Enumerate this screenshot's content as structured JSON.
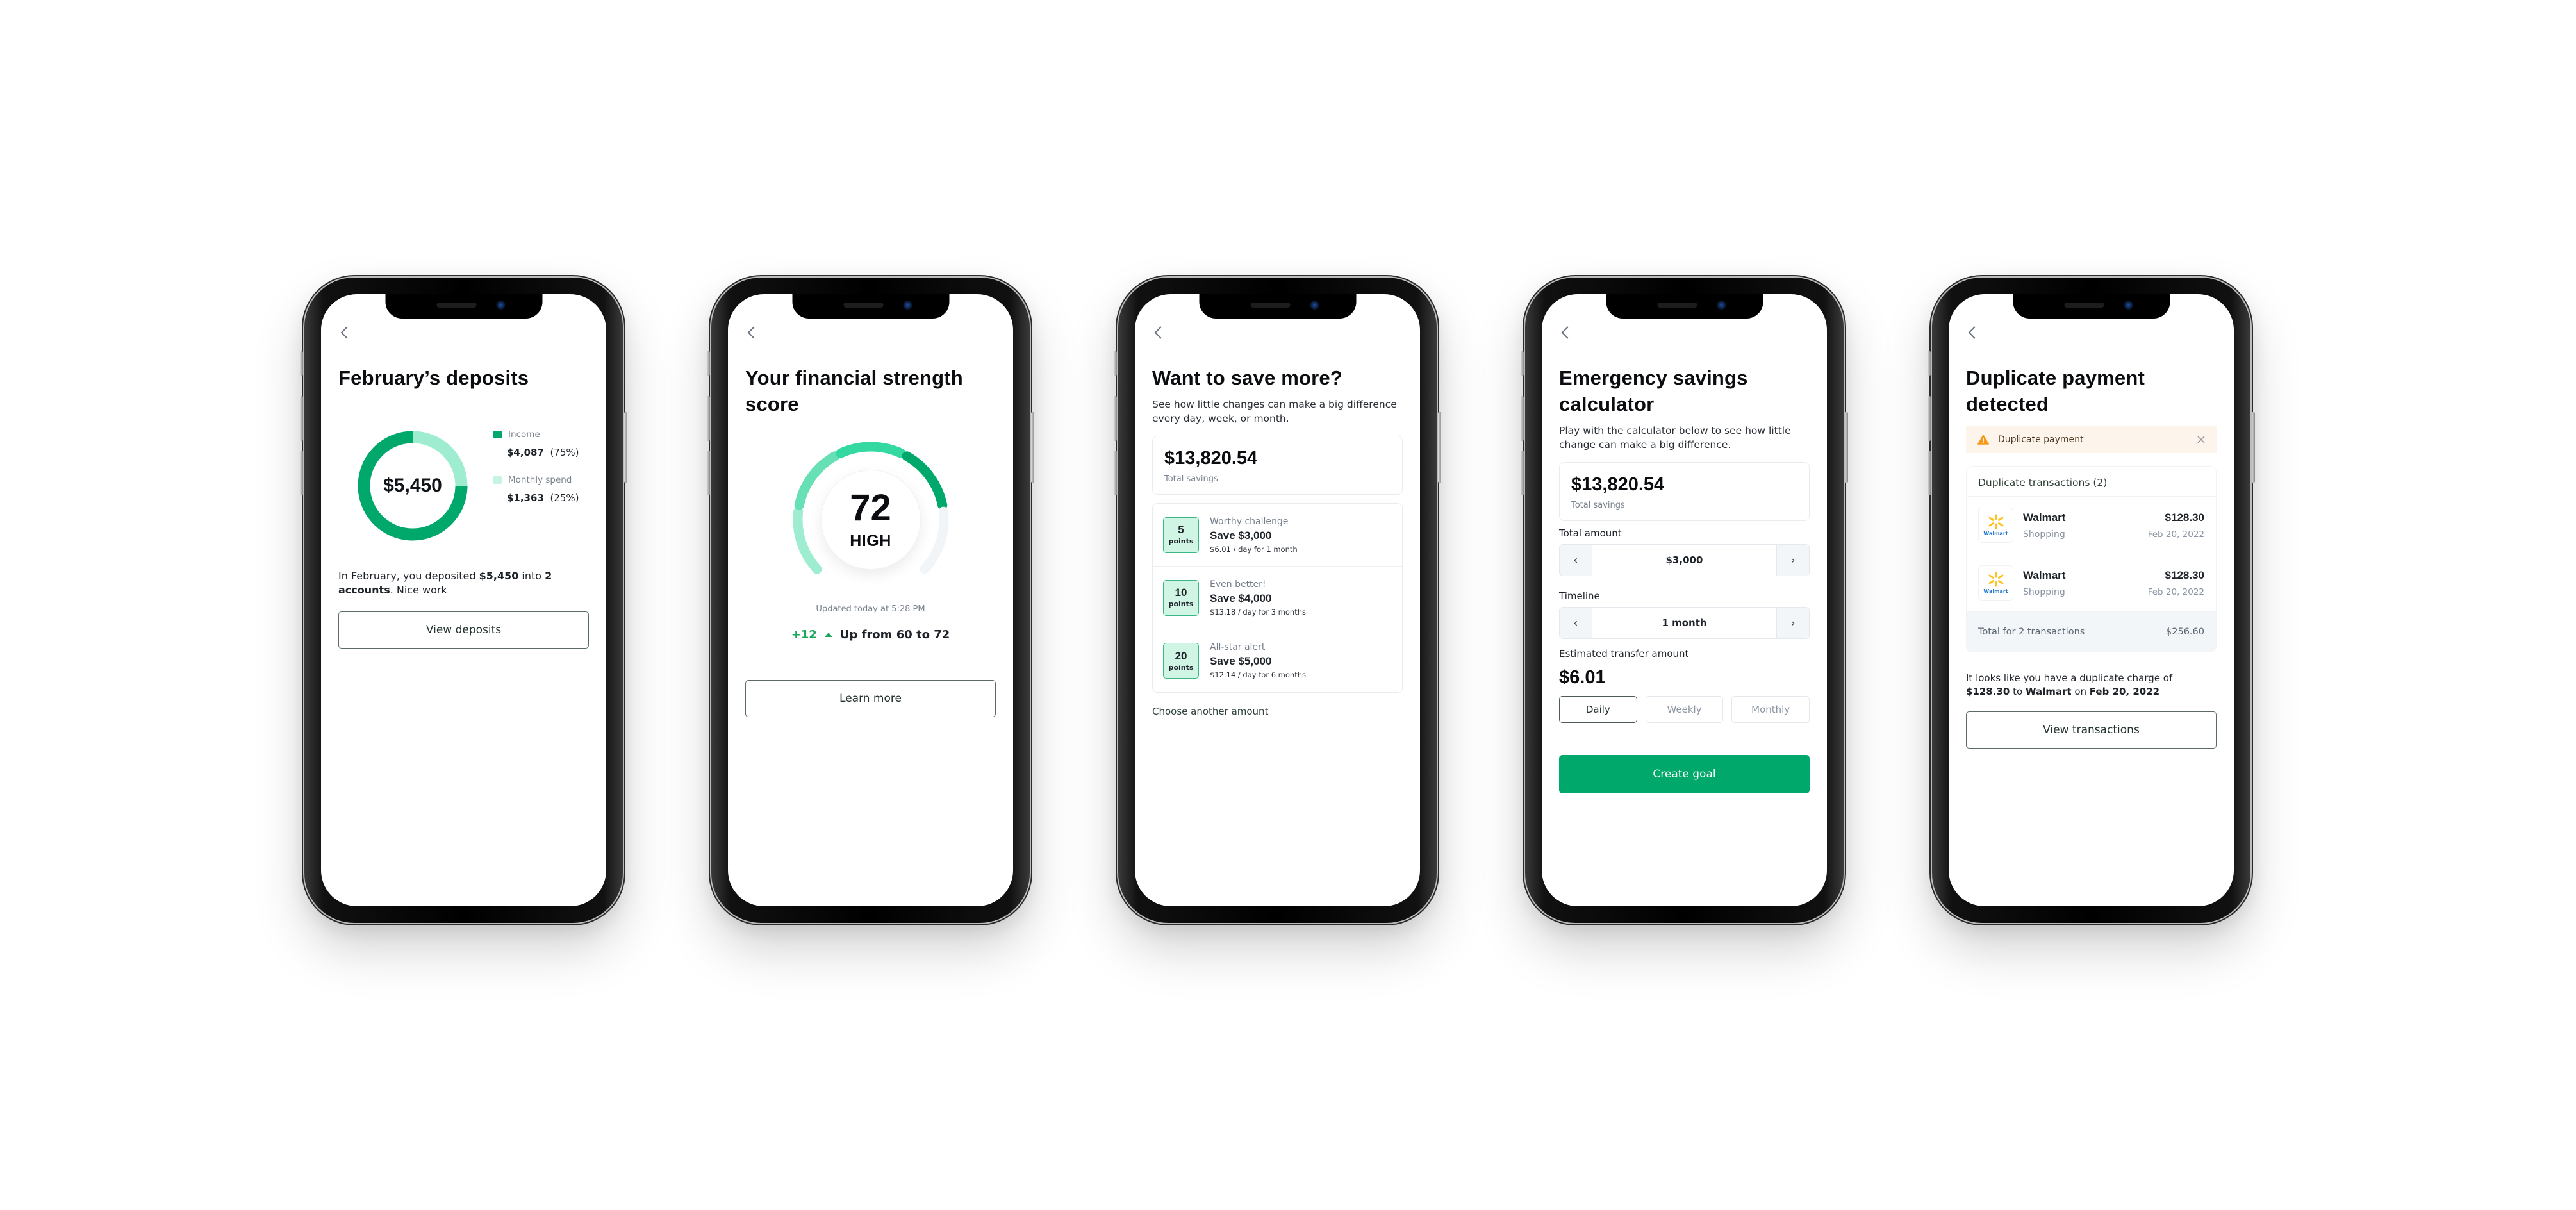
{
  "colors": {
    "accent_green": "#00a86b",
    "light_green": "#9eedd0",
    "mint": "#33d9a0",
    "warning_orange": "#f59a1b",
    "walmart_blue": "#1a73c9",
    "walmart_yellow": "#ffc220"
  },
  "phones": [
    {
      "id": "deposits",
      "title": "February’s deposits",
      "chart_data": {
        "type": "pie",
        "center_label": "$5,450",
        "slices": [
          {
            "name": "Income",
            "amount": "$4,087",
            "percent_label": "(75%)",
            "value": 75,
            "color": "#00a86b"
          },
          {
            "name": "Monthly spend",
            "amount": "$1,363",
            "percent_label": "(25%)",
            "value": 25,
            "color": "#9eedd0"
          }
        ]
      },
      "summary": {
        "pre": "In February, you deposited ",
        "amount": "$5,450",
        "mid": " into ",
        "accounts": "2 accounts",
        "post": ". Nice work"
      },
      "button": "View deposits"
    },
    {
      "id": "score",
      "title": "Your financial strength score",
      "score": "72",
      "level": "HIGH",
      "gauge_segments": [
        {
          "color": "#9eedd0",
          "filled": true
        },
        {
          "color": "#66e0b4",
          "filled": true
        },
        {
          "color": "#33d9a0",
          "filled": true
        },
        {
          "color": "#00a86b",
          "filled": true
        },
        {
          "color": "#f2f5f8",
          "filled": false
        }
      ],
      "updated": "Updated today at 5:28 PM",
      "delta": "+12",
      "delta_text": "Up from 60 to 72",
      "button": "Learn more"
    },
    {
      "id": "save-more",
      "title": "Want to save more?",
      "subtitle": "See how little changes can make a big difference every day, week, or month.",
      "total_savings": "$13,820.54",
      "total_savings_label": "Total savings",
      "challenges": [
        {
          "points": "5",
          "points_label": "points",
          "kicker": "Worthy challenge",
          "title": "Save $3,000",
          "sub": "$6.01 / day for 1 month"
        },
        {
          "points": "10",
          "points_label": "points",
          "kicker": "Even better!",
          "title": "Save $4,000",
          "sub": "$13.18 / day for 3 months"
        },
        {
          "points": "20",
          "points_label": "points",
          "kicker": "All-star alert",
          "title": "Save $5,000",
          "sub": "$12.14 / day for 6 months"
        }
      ],
      "link": "Choose another amount"
    },
    {
      "id": "calculator",
      "title": "Emergency savings calculator",
      "subtitle": "Play with the calculator below to see how little change can make a big difference.",
      "total_savings": "$13,820.54",
      "total_savings_label": "Total savings",
      "total_amount_label": "Total amount",
      "total_amount": "$3,000",
      "timeline_label": "Timeline",
      "timeline": "1 month",
      "estimate_label": "Estimated transfer amount",
      "estimate": "$6.01",
      "frequencies": [
        {
          "label": "Daily",
          "active": true
        },
        {
          "label": "Weekly",
          "active": false
        },
        {
          "label": "Monthly",
          "active": false
        }
      ],
      "prev_glyph": "‹",
      "next_glyph": "›",
      "button": "Create goal"
    },
    {
      "id": "duplicate",
      "title": "Duplicate payment detected",
      "alert": "Duplicate payment",
      "list_header": "Duplicate transactions (2)",
      "transactions": [
        {
          "merchant": "Walmart",
          "logo_text": "Walmart",
          "category": "Shopping",
          "amount": "$128.30",
          "date": "Feb 20, 2022"
        },
        {
          "merchant": "Walmart",
          "logo_text": "Walmart",
          "category": "Shopping",
          "amount": "$128.30",
          "date": "Feb 20, 2022"
        }
      ],
      "total_label": "Total for 2 transactions",
      "total_value": "$256.60",
      "message": {
        "pre": "It looks like you have a duplicate charge of ",
        "amount": "$128.30",
        "mid1": " to ",
        "merchant": "Walmart",
        "mid2": " on ",
        "date": "Feb 20, 2022"
      },
      "button": "View transactions"
    }
  ]
}
